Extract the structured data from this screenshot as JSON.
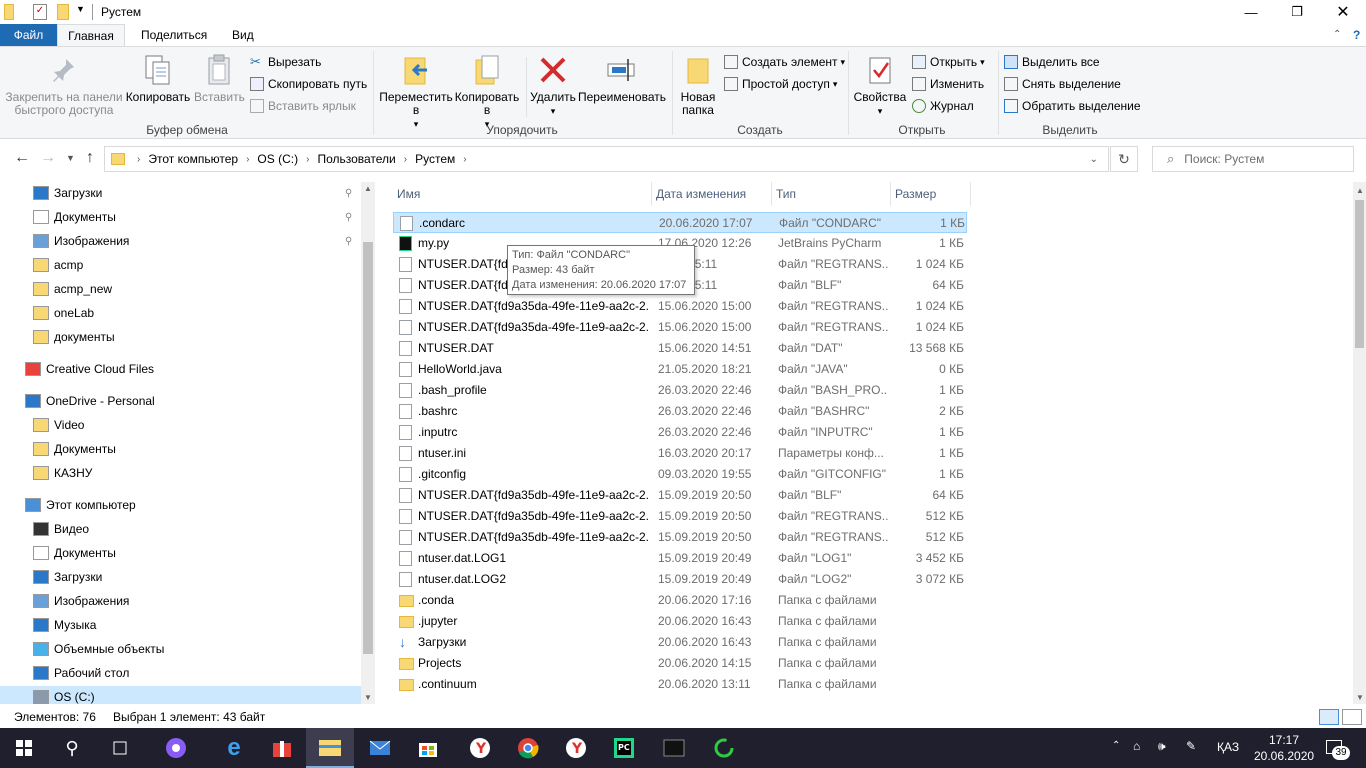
{
  "window": {
    "title": "Рустем"
  },
  "tabs": {
    "file": "Файл",
    "home": "Главная",
    "share": "Поделиться",
    "view": "Вид"
  },
  "ribbon": {
    "pin": "Закрепить на панели быстрого доступа",
    "copy": "Копировать",
    "paste": "Вставить",
    "cut": "Вырезать",
    "copy_path": "Скопировать путь",
    "paste_shortcut": "Вставить ярлык",
    "group_clipboard": "Буфер обмена",
    "move": "Переместить в",
    "copy_to": "Копировать в",
    "delete": "Удалить",
    "rename": "Переименовать",
    "group_organize": "Упорядочить",
    "new_folder": "Новая папка",
    "new_item": "Создать элемент",
    "easy_access": "Простой доступ",
    "group_new": "Создать",
    "properties": "Свойства",
    "open": "Открыть",
    "edit": "Изменить",
    "history": "Журнал",
    "group_open": "Открыть",
    "select_all": "Выделить все",
    "select_none": "Снять выделение",
    "invert": "Обратить выделение",
    "group_select": "Выделить"
  },
  "address": {
    "crumbs": [
      "Этот компьютер",
      "OS (C:)",
      "Пользователи",
      "Рустем"
    ],
    "search_placeholder": "Поиск: Рустем"
  },
  "nav": {
    "items": [
      "Загрузки",
      "Документы",
      "Изображения",
      "acmp",
      "acmp_new",
      "oneLab",
      "документы",
      "Creative Cloud Files",
      "OneDrive - Personal",
      "Video",
      "Документы",
      "КАЗНУ",
      "Этот компьютер",
      "Видео",
      "Документы",
      "Загрузки",
      "Изображения",
      "Музыка",
      "Объемные объекты",
      "Рабочий стол",
      "OS (C:)"
    ]
  },
  "columns": {
    "name": "Имя",
    "date": "Дата изменения",
    "type": "Тип",
    "size": "Размер"
  },
  "files": [
    {
      "name": ".condarc",
      "date": "20.06.2020 17:07",
      "type": "Файл \"CONDARC\"",
      "size": "1 КБ"
    },
    {
      "name": "my.py",
      "date": "17.06.2020 12:26",
      "type": "JetBrains PyCharm",
      "size": "1 КБ"
    },
    {
      "name": "NTUSER.DAT{fd9",
      "date": "2020 15:11",
      "type": "Файл \"REGTRANS...",
      "size": "1 024 КБ"
    },
    {
      "name": "NTUSER.DAT{fd9",
      "date": "2020 15:11",
      "type": "Файл \"BLF\"",
      "size": "64 КБ"
    },
    {
      "name": "NTUSER.DAT{fd9a35da-49fe-11e9-aa2c-2...",
      "date": "15.06.2020 15:00",
      "type": "Файл \"REGTRANS...",
      "size": "1 024 КБ"
    },
    {
      "name": "NTUSER.DAT{fd9a35da-49fe-11e9-aa2c-2...",
      "date": "15.06.2020 15:00",
      "type": "Файл \"REGTRANS...",
      "size": "1 024 КБ"
    },
    {
      "name": "NTUSER.DAT",
      "date": "15.06.2020 14:51",
      "type": "Файл \"DAT\"",
      "size": "13 568 КБ"
    },
    {
      "name": "HelloWorld.java",
      "date": "21.05.2020 18:21",
      "type": "Файл \"JAVA\"",
      "size": "0 КБ"
    },
    {
      "name": ".bash_profile",
      "date": "26.03.2020 22:46",
      "type": "Файл \"BASH_PRO...",
      "size": "1 КБ"
    },
    {
      "name": ".bashrc",
      "date": "26.03.2020 22:46",
      "type": "Файл \"BASHRC\"",
      "size": "2 КБ"
    },
    {
      "name": ".inputrc",
      "date": "26.03.2020 22:46",
      "type": "Файл \"INPUTRC\"",
      "size": "1 КБ"
    },
    {
      "name": "ntuser.ini",
      "date": "16.03.2020 20:17",
      "type": "Параметры конф...",
      "size": "1 КБ"
    },
    {
      "name": ".gitconfig",
      "date": "09.03.2020 19:55",
      "type": "Файл \"GITCONFIG\"",
      "size": "1 КБ"
    },
    {
      "name": "NTUSER.DAT{fd9a35db-49fe-11e9-aa2c-2...",
      "date": "15.09.2019 20:50",
      "type": "Файл \"BLF\"",
      "size": "64 КБ"
    },
    {
      "name": "NTUSER.DAT{fd9a35db-49fe-11e9-aa2c-2...",
      "date": "15.09.2019 20:50",
      "type": "Файл \"REGTRANS...",
      "size": "512 КБ"
    },
    {
      "name": "NTUSER.DAT{fd9a35db-49fe-11e9-aa2c-2...",
      "date": "15.09.2019 20:50",
      "type": "Файл \"REGTRANS...",
      "size": "512 КБ"
    },
    {
      "name": "ntuser.dat.LOG1",
      "date": "15.09.2019 20:49",
      "type": "Файл \"LOG1\"",
      "size": "3 452 КБ"
    },
    {
      "name": "ntuser.dat.LOG2",
      "date": "15.09.2019 20:49",
      "type": "Файл \"LOG2\"",
      "size": "3 072 КБ"
    },
    {
      "name": ".conda",
      "date": "20.06.2020 17:16",
      "type": "Папка с файлами",
      "size": ""
    },
    {
      "name": ".jupyter",
      "date": "20.06.2020 16:43",
      "type": "Папка с файлами",
      "size": ""
    },
    {
      "name": "Загрузки",
      "date": "20.06.2020 16:43",
      "type": "Папка с файлами",
      "size": ""
    },
    {
      "name": "Projects",
      "date": "20.06.2020 14:15",
      "type": "Папка с файлами",
      "size": ""
    },
    {
      "name": ".continuum",
      "date": "20.06.2020 13:11",
      "type": "Папка с файлами",
      "size": ""
    }
  ],
  "tooltip": {
    "line1": "Тип: Файл \"CONDARC\"",
    "line2": "Размер: 43 байт",
    "line3": "Дата изменения: 20.06.2020 17:07"
  },
  "status": {
    "count": "Элементов: 76",
    "selected": "Выбран 1 элемент: 43 байт"
  },
  "taskbar": {
    "lang": "ҚАЗ",
    "time": "17:17",
    "date": "20.06.2020",
    "badge": "39"
  }
}
